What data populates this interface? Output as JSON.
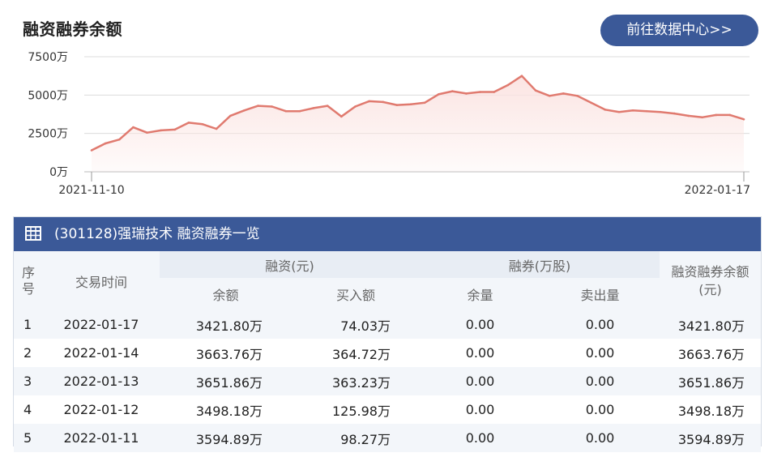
{
  "header": {
    "title": "融资融券余额",
    "link_label": "前往数据中心>>"
  },
  "chart_data": {
    "type": "area",
    "y_ticks": [
      "7500万",
      "5000万",
      "2500万",
      "0万"
    ],
    "y_values": [
      7500,
      5000,
      2500,
      0
    ],
    "ylim": [
      0,
      7500
    ],
    "x_labels": [
      "2021-11-10",
      "2022-01-17"
    ],
    "values": [
      1400,
      1850,
      2100,
      2900,
      2550,
      2700,
      2750,
      3200,
      3100,
      2800,
      3650,
      4000,
      4300,
      4250,
      3950,
      3950,
      4150,
      4300,
      3600,
      4250,
      4600,
      4550,
      4350,
      4400,
      4500,
      5050,
      5250,
      5100,
      5200,
      5200,
      5650,
      6250,
      5300,
      4950,
      5100,
      4950,
      4500,
      4050,
      3900,
      4000,
      3950,
      3900,
      3800,
      3650,
      3550,
      3700,
      3700,
      3420
    ],
    "line_color": "#e07a6f",
    "fill_color": "#fbe3e1",
    "grid": true
  },
  "table": {
    "title": "(301128)强瑞技术 融资融券一览",
    "headers": {
      "seq": "序号",
      "time": "交易时间",
      "financing": "融资(元)",
      "securities": "融券(万股)",
      "total": "融资融券余额(元)",
      "balance": "余额",
      "buy": "买入额",
      "remaining": "余量",
      "sold": "卖出量"
    },
    "rows": [
      [
        "1",
        "2022-01-17",
        "3421.80万",
        "74.03万",
        "0.00",
        "0.00",
        "3421.80万"
      ],
      [
        "2",
        "2022-01-14",
        "3663.76万",
        "364.72万",
        "0.00",
        "0.00",
        "3663.76万"
      ],
      [
        "3",
        "2022-01-13",
        "3651.86万",
        "363.23万",
        "0.00",
        "0.00",
        "3651.86万"
      ],
      [
        "4",
        "2022-01-12",
        "3498.18万",
        "125.98万",
        "0.00",
        "0.00",
        "3498.18万"
      ],
      [
        "5",
        "2022-01-11",
        "3594.89万",
        "98.27万",
        "0.00",
        "0.00",
        "3594.89万"
      ]
    ]
  }
}
